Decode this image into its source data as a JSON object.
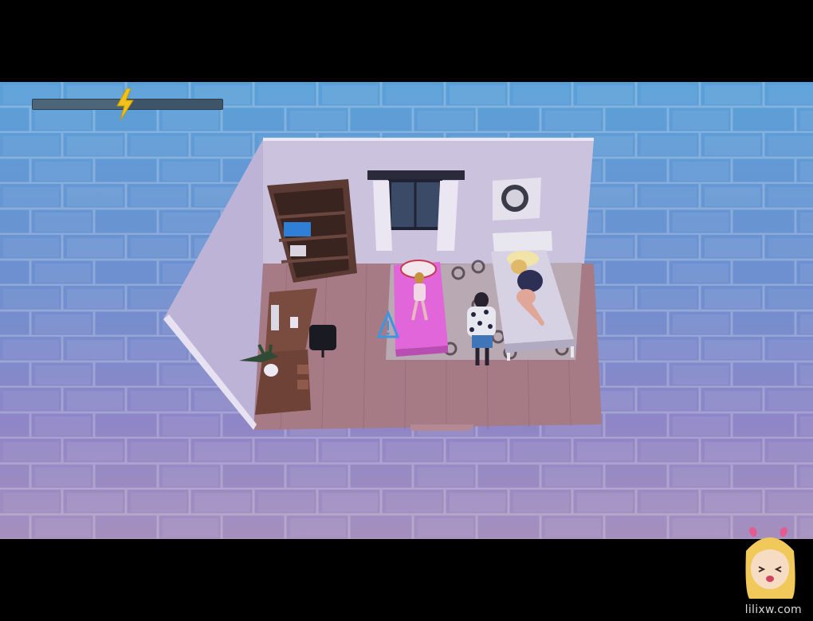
{
  "hud": {
    "energy": {
      "level_fraction": 0.5,
      "icon": "lightning-bolt-icon",
      "track_color": "#3e5468",
      "bolt_color": "#f2c21a"
    }
  },
  "scene": {
    "location": "bedroom",
    "colors": {
      "floor": "#a97f86",
      "wall": "#c8c0dd",
      "bed_girl": "#e066d9",
      "rug": "#b7a9b3"
    },
    "interaction_marker": {
      "icon": "warning-triangle-icon"
    }
  },
  "watermark": {
    "text": "lilixw.com"
  }
}
